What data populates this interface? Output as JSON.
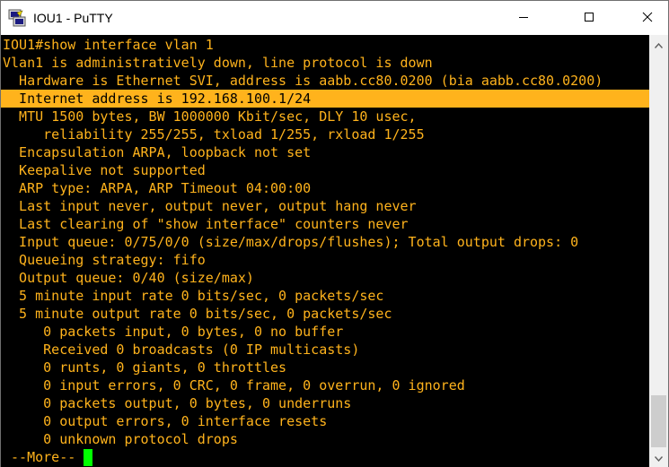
{
  "window": {
    "title": "IOU1 - PuTTY",
    "app_icon": "putty-icon",
    "controls": {
      "minimize_icon": "minimize-icon",
      "maximize_icon": "maximize-icon",
      "close_icon": "close-icon"
    }
  },
  "colors": {
    "terminal_bg": "#000000",
    "terminal_fg": "#ffb31c",
    "highlight_bg": "#ffb31c",
    "highlight_fg": "#000000",
    "cursor": "#00ff00"
  },
  "terminal": {
    "highlighted_line_index": 3,
    "lines": [
      "IOU1#show interface vlan 1",
      "Vlan1 is administratively down, line protocol is down",
      "  Hardware is Ethernet SVI, address is aabb.cc80.0200 (bia aabb.cc80.0200)",
      "  Internet address is 192.168.100.1/24",
      "  MTU 1500 bytes, BW 1000000 Kbit/sec, DLY 10 usec,",
      "     reliability 255/255, txload 1/255, rxload 1/255",
      "  Encapsulation ARPA, loopback not set",
      "  Keepalive not supported",
      "  ARP type: ARPA, ARP Timeout 04:00:00",
      "  Last input never, output never, output hang never",
      "  Last clearing of \"show interface\" counters never",
      "  Input queue: 0/75/0/0 (size/max/drops/flushes); Total output drops: 0",
      "  Queueing strategy: fifo",
      "  Output queue: 0/40 (size/max)",
      "  5 minute input rate 0 bits/sec, 0 packets/sec",
      "  5 minute output rate 0 bits/sec, 0 packets/sec",
      "     0 packets input, 0 bytes, 0 no buffer",
      "     Received 0 broadcasts (0 IP multicasts)",
      "     0 runts, 0 giants, 0 throttles",
      "     0 input errors, 0 CRC, 0 frame, 0 overrun, 0 ignored",
      "     0 packets output, 0 bytes, 0 underruns",
      "     0 output errors, 0 interface resets",
      "     0 unknown protocol drops",
      " --More-- "
    ]
  },
  "scrollbar": {
    "up_icon": "scroll-up-arrow-icon",
    "down_icon": "scroll-down-arrow-icon"
  }
}
